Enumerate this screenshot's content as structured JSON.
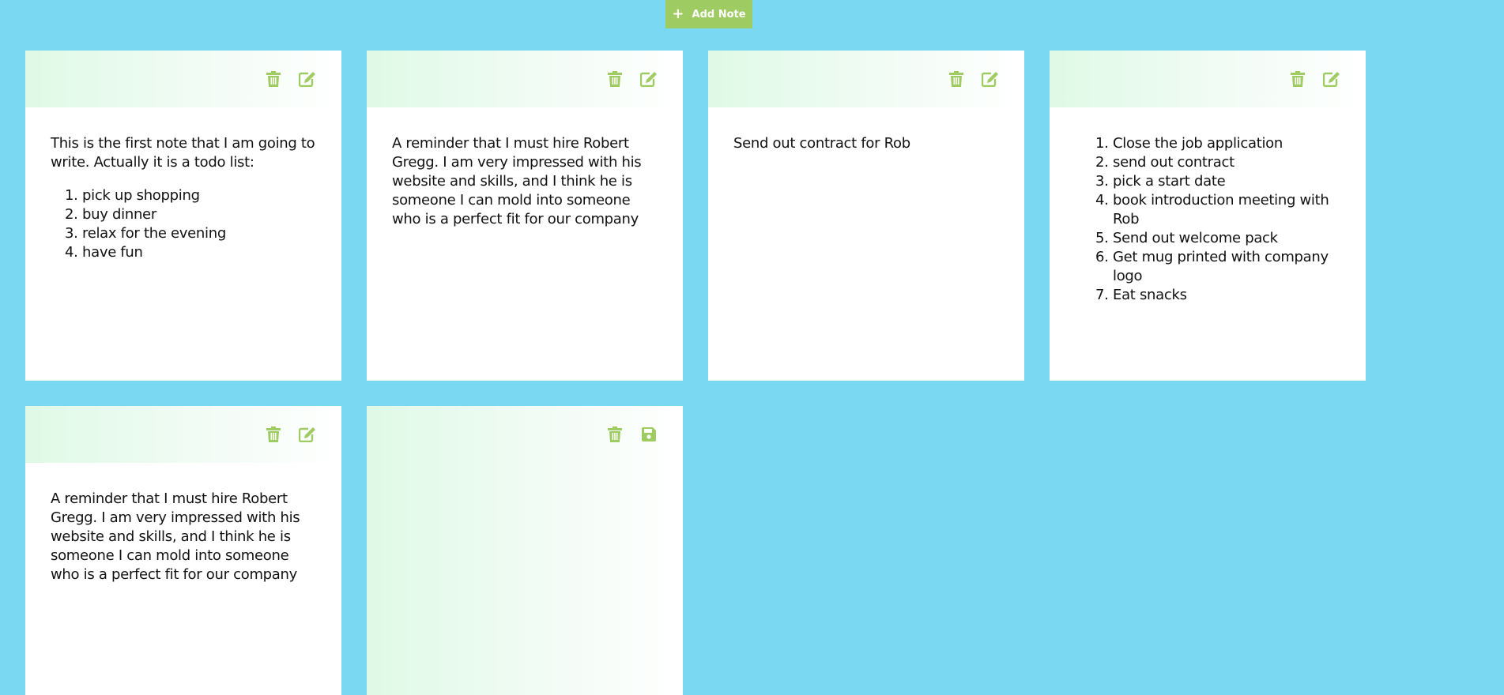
{
  "toolbar": {
    "add_note_label": "Add Note",
    "add_note_icon": "plus-icon"
  },
  "colors": {
    "background": "#7bd8f2",
    "accent": "#9fcb63",
    "note_header_gradient_start": "#dff9e6",
    "note_body": "#ffffff"
  },
  "notes": [
    {
      "text": "This is the first note that I am going to write. Actually it is a todo list:",
      "list": [
        "pick up shopping",
        "buy dinner",
        "relax for the evening",
        "have fun"
      ],
      "actions": [
        "trash-icon",
        "edit-icon"
      ]
    },
    {
      "text": "A reminder that I must hire Robert Gregg. I am very impressed with his website and skills, and I think he is someone I can mold into someone who is a perfect fit for our company",
      "actions": [
        "trash-icon",
        "edit-icon"
      ]
    },
    {
      "text": "Send out contract for Rob",
      "actions": [
        "trash-icon",
        "edit-icon"
      ]
    },
    {
      "list": [
        "Close the job application",
        "send out contract",
        "pick a start date",
        "book introduction meeting with Rob",
        "Send out welcome pack",
        "Get mug printed with company logo",
        "Eat snacks"
      ],
      "actions": [
        "trash-icon",
        "edit-icon"
      ]
    },
    {
      "text": "A reminder that I must hire Robert Gregg. I am very impressed with his website and skills, and I think he is someone I can mold into someone who is a perfect fit for our company",
      "actions": [
        "trash-icon",
        "edit-icon"
      ]
    },
    {
      "text": "",
      "actions": [
        "trash-icon",
        "save-icon"
      ]
    }
  ]
}
